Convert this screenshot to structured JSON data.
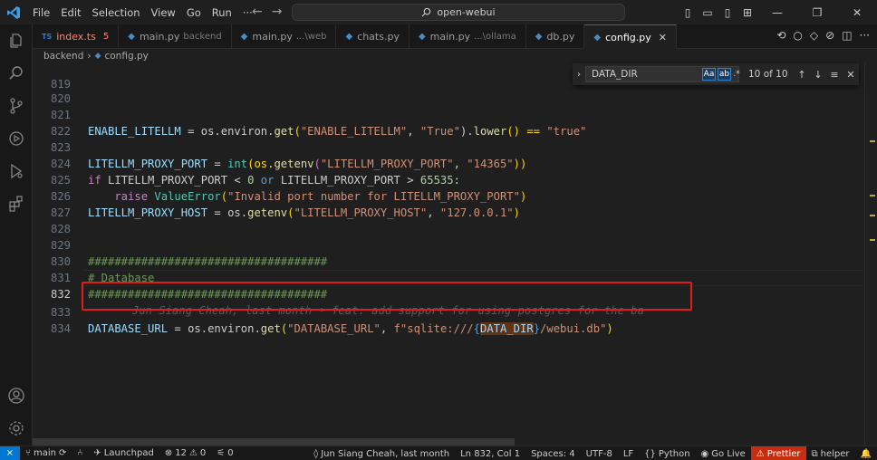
{
  "titlebar": {
    "menu": [
      "File",
      "Edit",
      "Selection",
      "View",
      "Go",
      "Run",
      "···"
    ],
    "search": "open-webui"
  },
  "tabs": [
    {
      "icon": "TS",
      "label": "index.ts",
      "desc": "",
      "count": "5",
      "kind": "ts"
    },
    {
      "icon": "py",
      "label": "main.py",
      "desc": "backend"
    },
    {
      "icon": "py",
      "label": "main.py",
      "desc": "...\\web"
    },
    {
      "icon": "py",
      "label": "chats.py",
      "desc": ""
    },
    {
      "icon": "py",
      "label": "main.py",
      "desc": "...\\ollama"
    },
    {
      "icon": "py",
      "label": "db.py",
      "desc": ""
    },
    {
      "icon": "py",
      "label": "config.py",
      "desc": "",
      "active": true
    }
  ],
  "breadcrumb": {
    "folder": "backend",
    "file": "config.py"
  },
  "find": {
    "query": "DATA_DIR",
    "match_case": "Aa",
    "whole_word": "ab",
    "regex": ".*",
    "result": "10 of 10"
  },
  "editor": {
    "line_numbers": [
      "819",
      "820",
      "821",
      "822",
      "823",
      "824",
      "825",
      "826",
      "827",
      "828",
      "829",
      "830",
      "831",
      "832",
      "833",
      "834"
    ],
    "blame": "Jun Siang Cheah, last month • feat: add support for using postgres for the ba",
    "line821": {
      "a": "ENABLE_LITELLM",
      "b": " = os.environ.",
      "c": "get",
      "d": "(",
      "e": "\"ENABLE_LITELLM\"",
      "f": ", ",
      "g": "\"True\"",
      "h": ").",
      "i": "lower",
      "j": "() == ",
      "k": "\"true\""
    },
    "line823": {
      "a": "LITELLM_PROXY_PORT",
      "b": " = ",
      "c": "int",
      "d": "(os.",
      "e": "getenv",
      "f": "(",
      "g": "\"LITELLM_PROXY_PORT\"",
      "h": ", ",
      "i": "\"14365\"",
      "j": "))"
    },
    "line824": {
      "a": "if",
      "b": " LITELLM_PROXY_PORT < ",
      "c": "0",
      "d": " or",
      "e": " LITELLM_PROXY_PORT > ",
      "f": "65535",
      "g": ":"
    },
    "line825": {
      "a": "    raise",
      "b": " ",
      "c": "ValueError",
      "d": "(",
      "e": "\"Invalid port number for LITELLM_PROXY_PORT\"",
      "f": ")"
    },
    "line826": {
      "a": "LITELLM_PROXY_HOST",
      "b": " = os.",
      "c": "getenv",
      "d": "(",
      "e": "\"LITELLM_PROXY_HOST\"",
      "f": ", ",
      "g": "\"127.0.0.1\"",
      "h": ")"
    },
    "line829": "####################################",
    "line830": "# Database",
    "line831": "####################################",
    "line833": {
      "a": "DATABASE_URL",
      "b": " = os.environ.",
      "c": "get",
      "d": "(",
      "e": "\"DATABASE_URL\"",
      "f": ", ",
      "g": "f\"sqlite:///",
      "h": "{",
      "i": "DATA_DIR",
      "j": "}",
      "k": "/webui.db\"",
      "l": ")"
    }
  },
  "statusbar": {
    "remote": "⨯",
    "branch": "main",
    "launchpad": "Launchpad",
    "errors": "12",
    "warnings": "0",
    "ports": "0",
    "blame": "Jun Siang Cheah, last month",
    "position": "Ln 832, Col 1",
    "spaces": "Spaces: 4",
    "encoding": "UTF-8",
    "eol": "LF",
    "language": "Python",
    "golive": "Go Live",
    "prettier": "Prettier",
    "helper": "helper"
  },
  "colors": {
    "accent": "#0078d4",
    "highlight": "#e01c1c",
    "match": "#613214"
  }
}
